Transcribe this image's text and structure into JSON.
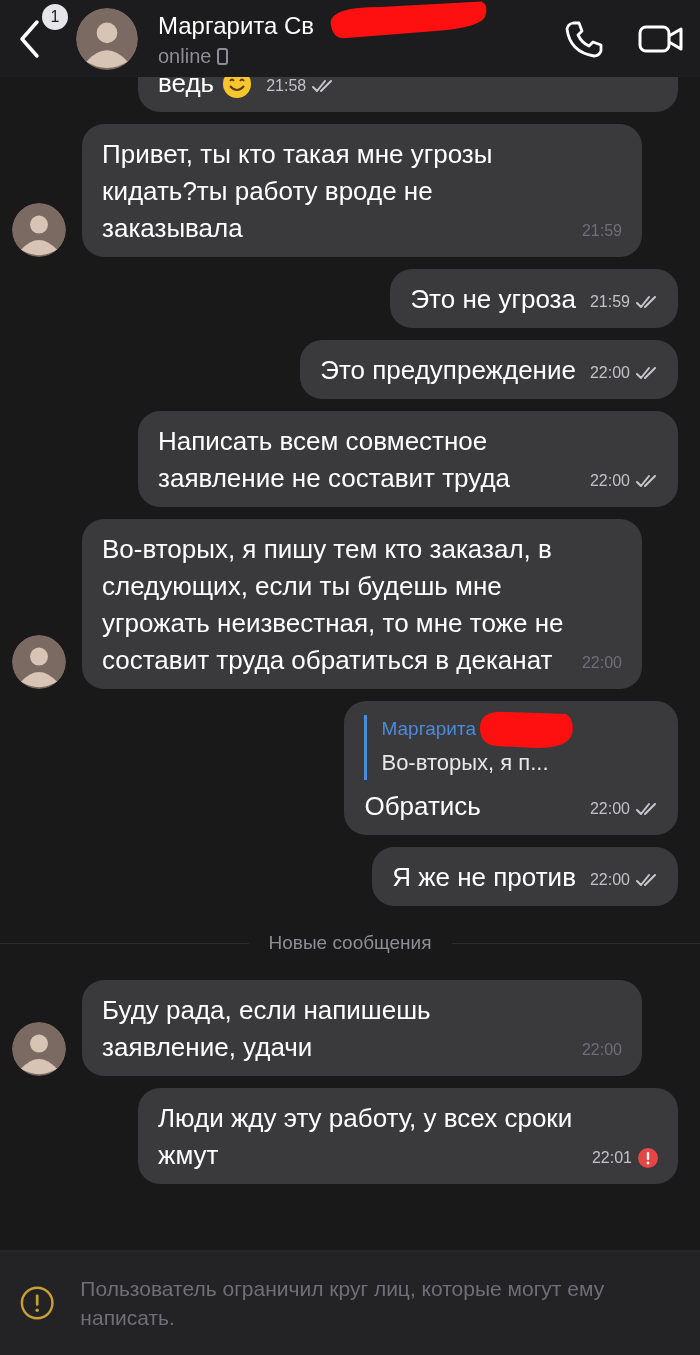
{
  "header": {
    "back_badge": "1",
    "name": "Маргарита Св",
    "name_redacted": true,
    "status": "online"
  },
  "messages": [
    {
      "kind": "outgoing",
      "text": "ведь",
      "emoji": true,
      "time": "21:58",
      "read": true,
      "failed": false,
      "cut_top": true
    },
    {
      "kind": "incoming",
      "text": "Привет, ты кто такая мне угрозы кидать?ты работу вроде не заказывала",
      "time": "21:59"
    },
    {
      "kind": "outgoing",
      "text": "Это не угроза",
      "time": "21:59",
      "read": true,
      "failed": false
    },
    {
      "kind": "outgoing",
      "text": "Это предупреждение",
      "time": "22:00",
      "read": true,
      "failed": false
    },
    {
      "kind": "outgoing",
      "text": "Написать всем совместное заявление не составит труда",
      "time": "22:00",
      "read": true,
      "failed": false
    },
    {
      "kind": "incoming",
      "text": "Во-вторых, я пишу тем кто заказал, в следующих, если ты будешь мне угрожать неизвестная, то мне тоже не составит труда обратиться в деканат",
      "time": "22:00"
    },
    {
      "kind": "outgoing",
      "reply": {
        "author": "Маргарита",
        "redacted": true,
        "text": "Во-вторых, я п..."
      },
      "text": "Обратись",
      "time": "22:00",
      "read": true,
      "failed": false
    },
    {
      "kind": "outgoing",
      "text": "Я же не против",
      "time": "22:00",
      "read": true,
      "failed": false
    },
    {
      "kind": "divider",
      "text": "Новые сообщения"
    },
    {
      "kind": "incoming",
      "text": "Буду рада, если напишешь заявление, удачи",
      "time": "22:00"
    },
    {
      "kind": "outgoing",
      "text": "Люди жду эту работу, у всех сроки жмут",
      "time": "22:01",
      "read": false,
      "failed": true
    }
  ],
  "footer": {
    "notice": "Пользователь ограничил круг лиц, которые могут ему написать."
  }
}
